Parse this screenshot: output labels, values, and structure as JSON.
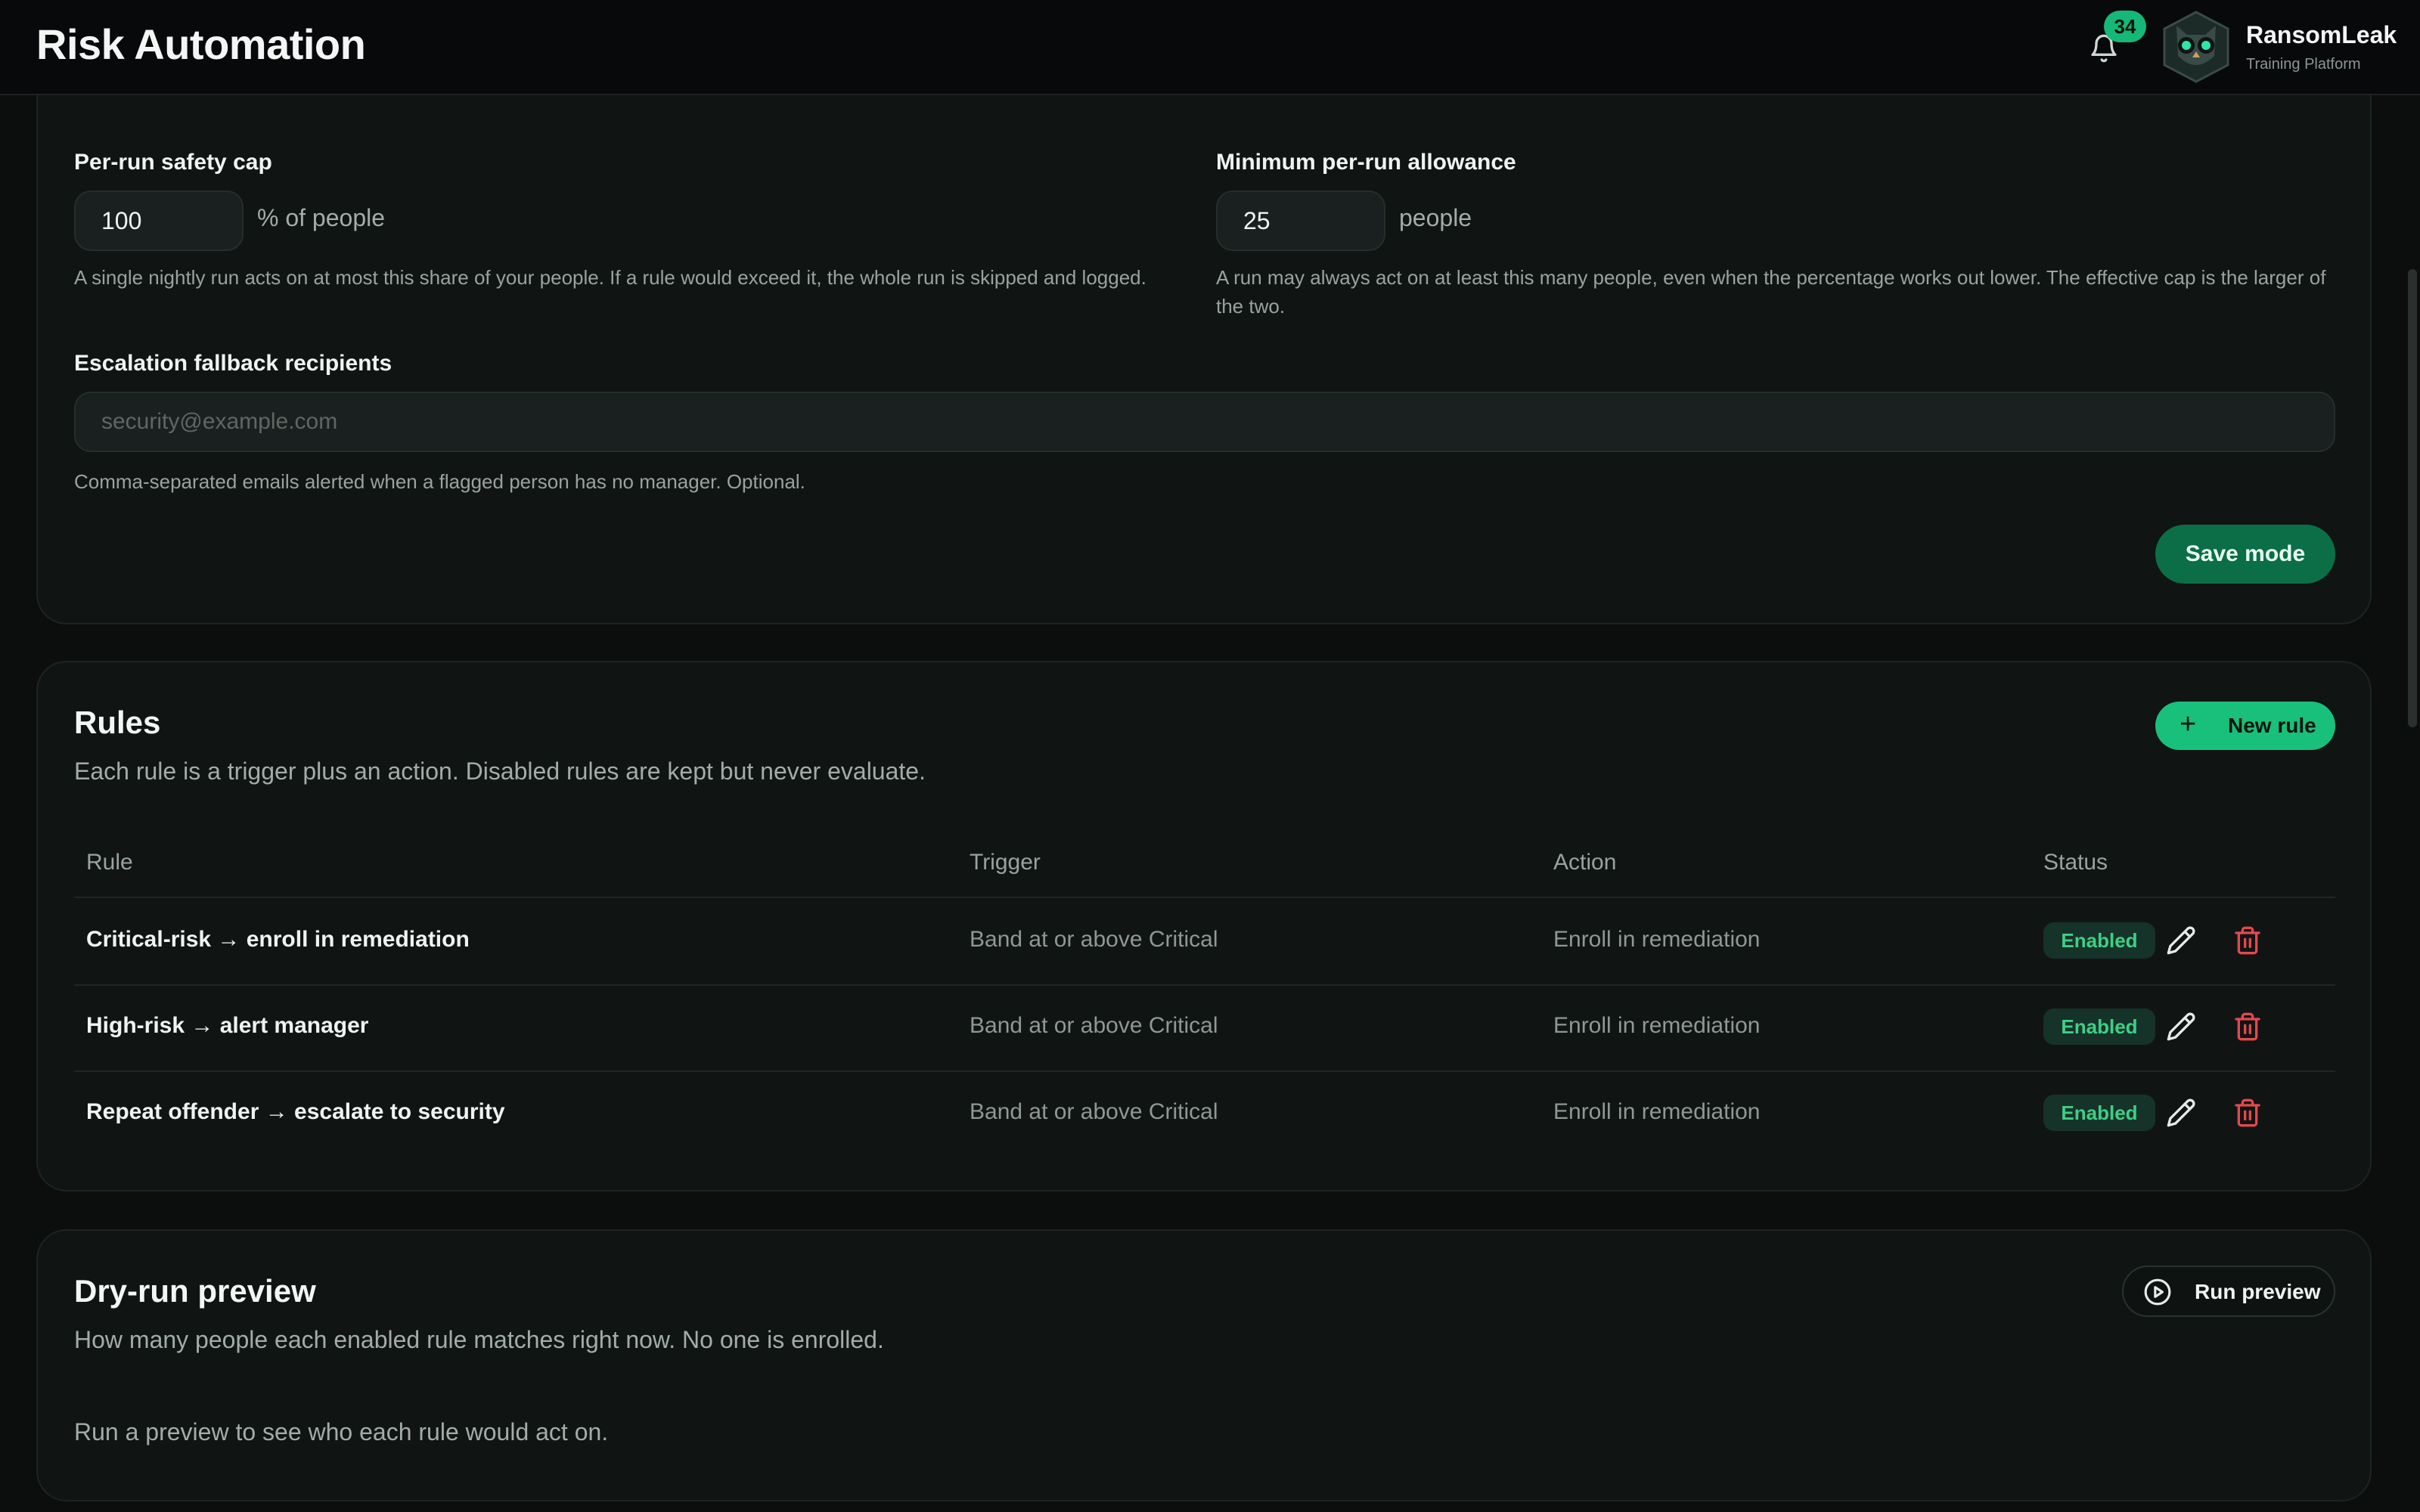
{
  "app": {
    "title": "Risk Automation",
    "notifications_count": "34",
    "brand_name": "RansomLeak",
    "brand_subtitle": "Training Platform"
  },
  "mode_settings": {
    "safety_cap": {
      "label": "Per-run safety cap",
      "value": "100",
      "unit": "% of people",
      "help": "A single nightly run acts on at most this share of your people. If a rule would exceed it, the whole run is skipped and logged."
    },
    "min_allowance": {
      "label": "Minimum per-run allowance",
      "value": "25",
      "unit": "people",
      "help": "A run may always act on at least this many people, even when the percentage works out lower. The effective cap is the larger of the two."
    },
    "fallback": {
      "label": "Escalation fallback recipients",
      "placeholder": "security@example.com",
      "help": "Comma-separated emails alerted when a flagged person has no manager. Optional."
    },
    "save_label": "Save mode"
  },
  "rules": {
    "title": "Rules",
    "subtitle": "Each rule is a trigger plus an action. Disabled rules are kept but never evaluate.",
    "new_rule_label": "New rule",
    "columns": [
      "Rule",
      "Trigger",
      "Action",
      "Status"
    ],
    "rows": [
      {
        "name": "Critical-risk → enroll in remediation",
        "trigger": "Band at or above Critical",
        "action": "Enroll in remediation",
        "status": "Enabled"
      },
      {
        "name": "High-risk → alert manager",
        "trigger": "Band at or above Critical",
        "action": "Enroll in remediation",
        "status": "Enabled"
      },
      {
        "name": "Repeat offender → escalate to security",
        "trigger": "Band at or above Critical",
        "action": "Enroll in remediation",
        "status": "Enabled"
      }
    ]
  },
  "preview": {
    "title": "Dry-run preview",
    "subtitle": "How many people each enabled rule matches right now. No one is enrolled.",
    "run_label": "Run preview",
    "empty_text": "Run a preview to see who each rule would act on."
  },
  "colors": {
    "accent": "#19c07c",
    "save_button": "#0b6e47",
    "enabled_text": "#3ecf84",
    "delete": "#e5484d"
  },
  "icons": [
    "bell-icon",
    "owl-avatar-icon",
    "plus-icon",
    "pencil-icon",
    "trash-icon",
    "play-circle-icon"
  ]
}
